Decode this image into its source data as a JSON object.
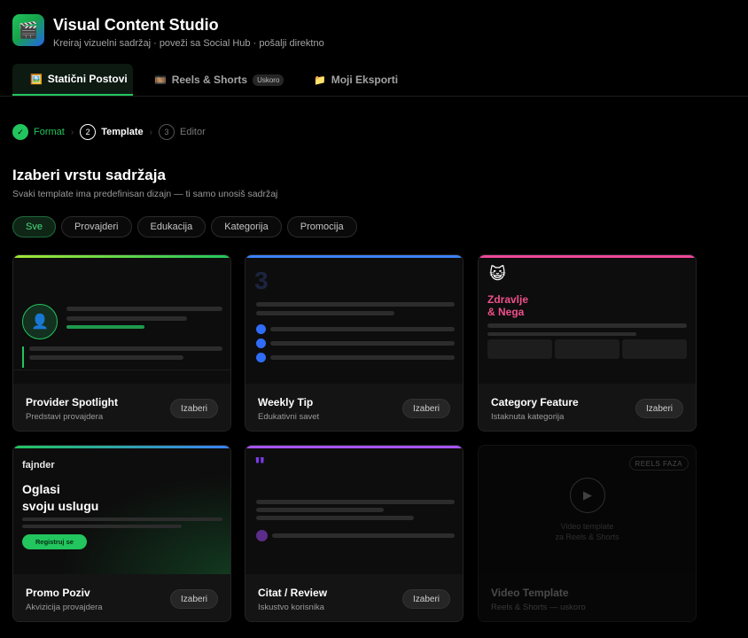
{
  "app": {
    "icon": "clapperboard-icon",
    "title": "Visual Content Studio",
    "subtitle": "Kreiraj vizuelni sadržaj · poveži sa Social Hub · pošalji direktno"
  },
  "tabs": [
    {
      "label": "Statični Postovi",
      "icon": "image-icon",
      "active": true
    },
    {
      "label": "Reels & Shorts",
      "icon": "film-icon",
      "badge": "Uskoro"
    },
    {
      "label": "Moji Eksporti",
      "icon": "folder-icon"
    }
  ],
  "stepper": [
    {
      "num": "✓",
      "label": "Format",
      "state": "done"
    },
    {
      "num": "2",
      "label": "Template",
      "state": "current"
    },
    {
      "num": "3",
      "label": "Editor",
      "state": "upcoming"
    }
  ],
  "section": {
    "title": "Izaberi vrstu sadržaja",
    "subtitle": "Svaki template ima predefinisan dizajn — ti samo unosiš sadržaj"
  },
  "filters": [
    "Sve",
    "Provajderi",
    "Edukacija",
    "Kategorija",
    "Promocija"
  ],
  "active_filter": "Sve",
  "cards": [
    {
      "name": "Provider Spotlight",
      "desc": "Predstavi provajdera",
      "button": "Izaberi",
      "accent": "#22c55e"
    },
    {
      "name": "Weekly Tip",
      "desc": "Edukativni savet",
      "button": "Izaberi",
      "accent": "#3b82f6",
      "number": "3"
    },
    {
      "name": "Category Feature",
      "desc": "Istaknuta kategorija",
      "button": "Izaberi",
      "accent": "#ec4899",
      "preview_title": "Zdravlje\n& Nega"
    },
    {
      "name": "Promo Poziv",
      "desc": "Akvizicija provajdera",
      "button": "Izaberi",
      "accent": "#22c55e",
      "brand": "fajnder",
      "preview_title": "Oglasi\nsvoju uslugu",
      "cta": "Registruj se"
    },
    {
      "name": "Citat / Review",
      "desc": "Iskustvo korisnika",
      "button": "Izaberi",
      "accent": "#a855f7"
    },
    {
      "name": "Video Template",
      "desc": "Reels & Shorts — uskoro",
      "badge": "REELS FAZA",
      "note": "Video template\nza Reels & Shorts",
      "disabled": true
    }
  ],
  "colors": {
    "accent": "#22c55e",
    "background": "#000000"
  }
}
